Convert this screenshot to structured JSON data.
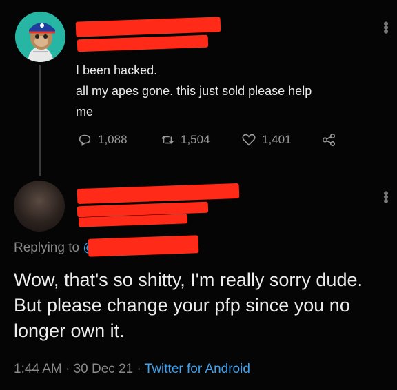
{
  "original_tweet": {
    "line1": "I been hacked.",
    "line2": "all my apes gone. this just sold please help",
    "line3": "me",
    "replies_count": "1,088",
    "retweets_count": "1,504",
    "likes_count": "1,401"
  },
  "reply": {
    "replying_to": "Replying to",
    "mention_prefix": "@",
    "text": "Wow, that's so shitty, I'm really sorry dude. But please change your pfp since you no longer own it.",
    "time": "1:44 AM",
    "date": "30 Dec 21",
    "source": "Twitter for Android",
    "separator": "·"
  },
  "colors": {
    "background": "#050505",
    "redaction": "#ff2a18",
    "link": "#3ea3f0",
    "muted": "#8a8a8a"
  }
}
